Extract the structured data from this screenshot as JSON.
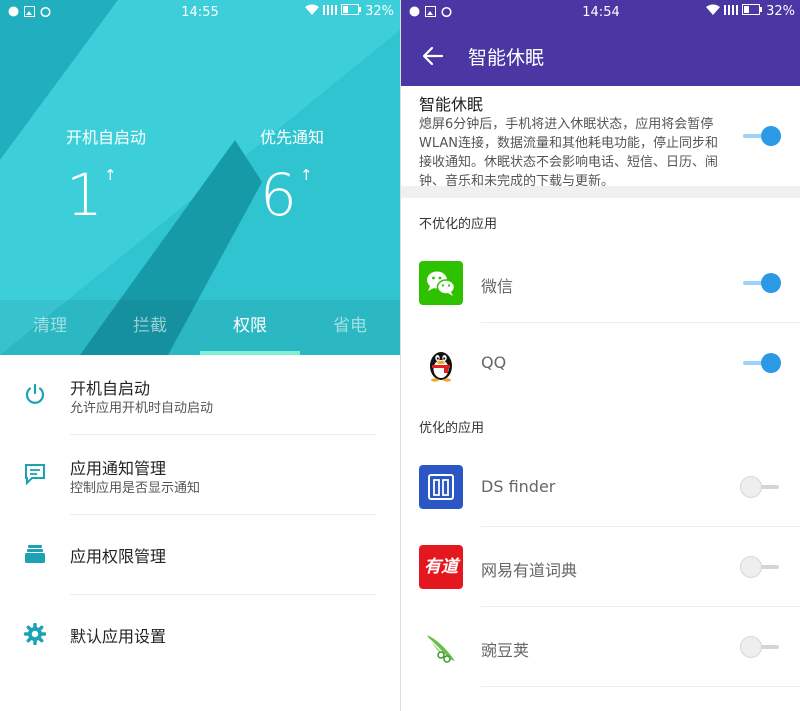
{
  "left": {
    "status": {
      "time": "14:55",
      "battery": "32%"
    },
    "stats": [
      {
        "label": "开机自启动",
        "value": "1",
        "arrow": "↑"
      },
      {
        "label": "优先通知",
        "value": "6",
        "arrow": "↑"
      }
    ],
    "tabs": [
      "清理",
      "拦截",
      "权限",
      "省电"
    ],
    "active_tab": "权限",
    "menu": [
      {
        "title": "开机自启动",
        "subtitle": "允许应用开机时自动启动",
        "icon": "power-icon"
      },
      {
        "title": "应用通知管理",
        "subtitle": "控制应用是否显示通知",
        "icon": "message-icon"
      },
      {
        "title": "应用权限管理",
        "subtitle": "",
        "icon": "layers-icon"
      },
      {
        "title": "默认应用设置",
        "subtitle": "",
        "icon": "gear-icon"
      }
    ],
    "colors": {
      "hero": "#2fc4d0",
      "accent": "#1ba3b5",
      "tab_indicator": "#7ff0d2"
    }
  },
  "right": {
    "status": {
      "time": "14:54",
      "battery": "32%"
    },
    "title": "智能休眠",
    "sleep": {
      "heading": "智能休眠",
      "description": "熄屏6分钟后，手机将进入休眠状态，应用将会暂停WLAN连接，数据流量和其他耗电功能，停止同步和接收通知。休眠状态不会影响电话、短信、日历、闹钟、音乐和未完成的下载与更新。",
      "enabled": true
    },
    "sections": {
      "unoptimized": "不优化的应用",
      "optimized": "优化的应用"
    },
    "unoptimized_apps": [
      {
        "name": "微信",
        "enabled": true,
        "icon": "wechat-icon"
      },
      {
        "name": "QQ",
        "enabled": true,
        "icon": "qq-icon"
      }
    ],
    "optimized_apps": [
      {
        "name": "DS finder",
        "enabled": false,
        "icon": "ds-finder-icon"
      },
      {
        "name": "网易有道词典",
        "enabled": false,
        "icon": "youdao-icon",
        "icon_text": "有道"
      },
      {
        "name": "豌豆荚",
        "enabled": false,
        "icon": "wandoujia-icon"
      }
    ],
    "colors": {
      "header": "#4a37a4",
      "toggle_on": "#2b9ae6"
    }
  }
}
